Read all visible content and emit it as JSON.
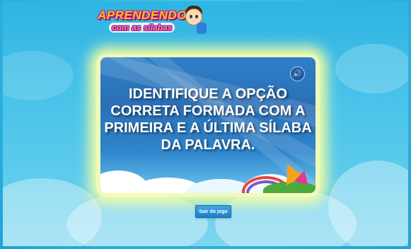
{
  "logo": {
    "line1": "APRENDENDO",
    "line2": "com as sílabas"
  },
  "card": {
    "instruction": "IDENTIFIQUE A OPÇÃO CORRETA FORMADA COM A PRIMEIRA E A ÚLTIMA SÍLABA DA PALAVRA.",
    "sound_icon": "speaker-icon"
  },
  "controls": {
    "exit_label": "Sair do jogo"
  },
  "colors": {
    "background": "#35b9e3",
    "card": "#2b6fb6",
    "glow": "#f6ffa0",
    "button": "#1e7fc4"
  }
}
